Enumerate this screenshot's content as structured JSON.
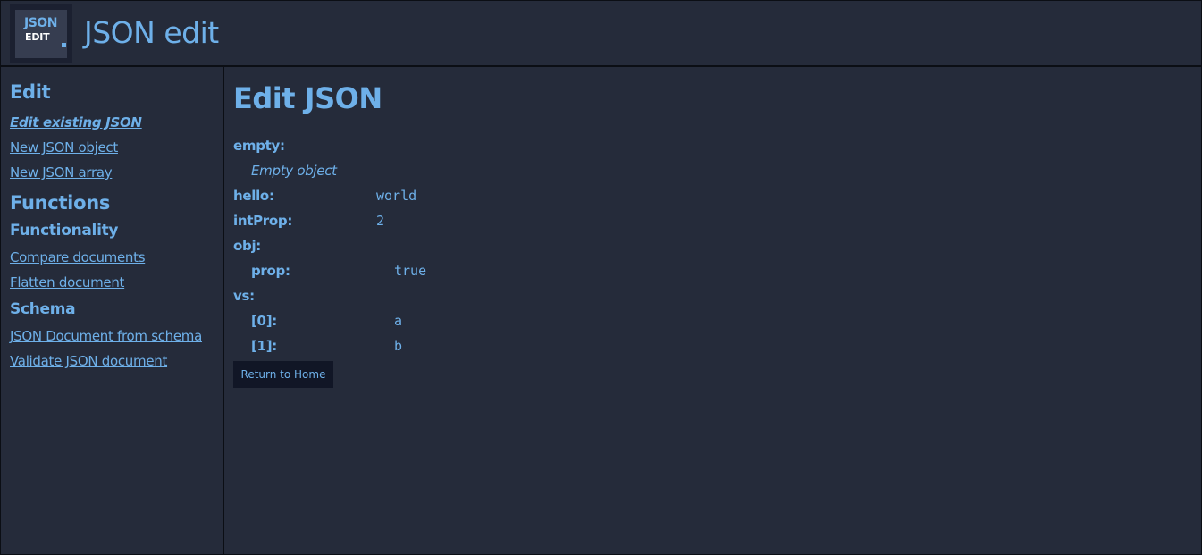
{
  "header": {
    "logo_text_top": "JSON",
    "logo_text_bottom": "EDIT",
    "title": "JSON edit"
  },
  "sidebar": {
    "edit_heading": "Edit",
    "edit_links": [
      {
        "label": "Edit existing JSON",
        "active": true
      },
      {
        "label": "New JSON object"
      },
      {
        "label": "New JSON array"
      }
    ],
    "functions_heading": "Functions",
    "functionality_heading": "Functionality",
    "functionality_links": [
      {
        "label": "Compare documents"
      },
      {
        "label": "Flatten document"
      }
    ],
    "schema_heading": "Schema",
    "schema_links": [
      {
        "label": "JSON Document from schema"
      },
      {
        "label": "Validate JSON document"
      }
    ]
  },
  "main": {
    "title": "Edit JSON",
    "entries": {
      "empty": {
        "key": "empty:",
        "note": "Empty object"
      },
      "hello": {
        "key": "hello:",
        "value": "world"
      },
      "intProp": {
        "key": "intProp:",
        "value": "2"
      },
      "obj": {
        "key": "obj:",
        "prop_key": "prop:",
        "prop_value": "true"
      },
      "vs": {
        "key": "vs:",
        "items": [
          {
            "key": "[0]:",
            "value": "a"
          },
          {
            "key": "[1]:",
            "value": "b"
          }
        ]
      }
    },
    "return_button": "Return to Home"
  },
  "colors": {
    "background": "#252b3a",
    "accent": "#6eb0e9",
    "border": "#0b0e14",
    "button_bg": "#111626"
  }
}
